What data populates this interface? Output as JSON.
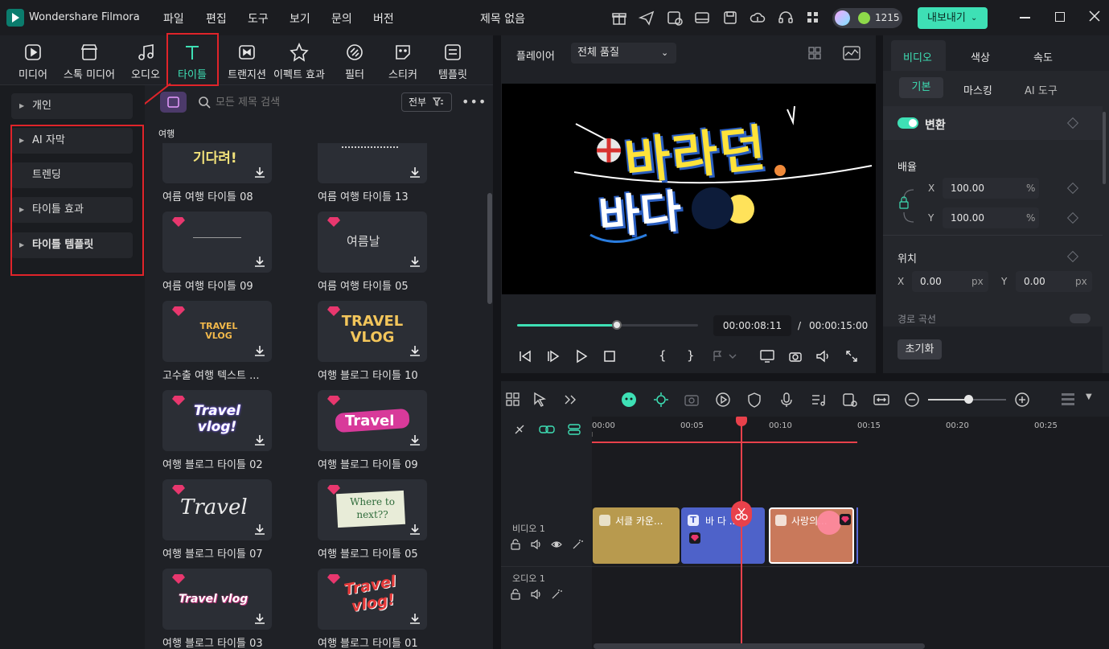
{
  "app": {
    "name": "Wondershare Filmora",
    "doc_title": "제목 없음",
    "credits": "1215",
    "export_label": "내보내기"
  },
  "menu": [
    "파일",
    "편집",
    "도구",
    "보기",
    "문의",
    "버전"
  ],
  "tabs": [
    "미디어",
    "스톡 미디어",
    "오디오",
    "타이틀",
    "트랜지션",
    "이펙트 효과",
    "필터",
    "스티커",
    "템플릿"
  ],
  "sidebar": {
    "items": [
      "개인",
      "AI 자막",
      "트렌딩",
      "타이틀 효과",
      "타이틀 템플릿"
    ]
  },
  "search": {
    "placeholder": "모든 제목 검색",
    "filter_label": "전부"
  },
  "section_label": "여행",
  "cards": [
    {
      "label": "여름 여행 타이틀 08",
      "thumb": "기다려!",
      "premium": false
    },
    {
      "label": "여름 여행 타이틀 13",
      "thumb": "",
      "premium": false
    },
    {
      "label": "여름 여행 타이틀 09",
      "thumb": "",
      "premium": true
    },
    {
      "label": "여름 여행 타이틀 05",
      "thumb": "여름날",
      "premium": true
    },
    {
      "label": "고수출 여행 텍스트 ...",
      "thumb": "TRAVEL VLOG",
      "premium": true
    },
    {
      "label": "여행 블로그 타이틀 10",
      "thumb": "TRAVEL VLOG",
      "premium": true
    },
    {
      "label": "여행 블로그 타이틀 02",
      "thumb": "Travel vlog!",
      "premium": true
    },
    {
      "label": "여행 블로그 타이틀 09",
      "thumb": "Travel",
      "premium": true
    },
    {
      "label": "여행 블로그 타이틀 07",
      "thumb": "Travel",
      "premium": true
    },
    {
      "label": "여행 블로그 타이틀 05",
      "thumb": "Where to next??",
      "premium": true
    },
    {
      "label": "여행 블로그 타이틀 03",
      "thumb": "Travel vlog",
      "premium": true
    },
    {
      "label": "여행 블로그 타이틀 01",
      "thumb": "Travel vlog!",
      "premium": true
    }
  ],
  "player": {
    "label": "플레이어",
    "quality": "전체 품질",
    "preview_text_1": "바라던",
    "preview_text_2": "바다",
    "current_time": "00:00:08:11",
    "separator": "/",
    "total_time": "00:00:15:00",
    "progress": 0.55
  },
  "props": {
    "tabs": [
      "비디오",
      "색상",
      "속도"
    ],
    "subtabs": [
      "기본",
      "마스킹",
      "AI 도구"
    ],
    "transform_label": "변환",
    "scale_label": "배율",
    "x_label": "X",
    "x_value": "100.00",
    "y_label": "Y",
    "y_value": "100.00",
    "pct": "%",
    "position_label": "위치",
    "pos_x_value": "0.00",
    "pos_y_value": "0.00",
    "px": "px",
    "path_curve_label": "경로 곡선",
    "reset_label": "초기화"
  },
  "timeline": {
    "ruler": [
      "00:00",
      "00:05",
      "00:10",
      "00:15",
      "00:20",
      "00:25"
    ],
    "video_track": "비디오 1",
    "audio_track": "오디오 1",
    "clips": [
      "서클 카운...",
      "바 다 ...",
      "사랑의..."
    ]
  },
  "colors": {
    "accent": "#3ee0b5",
    "clip1": "#b89a4e",
    "clip2": "#4e62c9",
    "clip3": "#c9795b",
    "playhead": "#e8414b"
  }
}
